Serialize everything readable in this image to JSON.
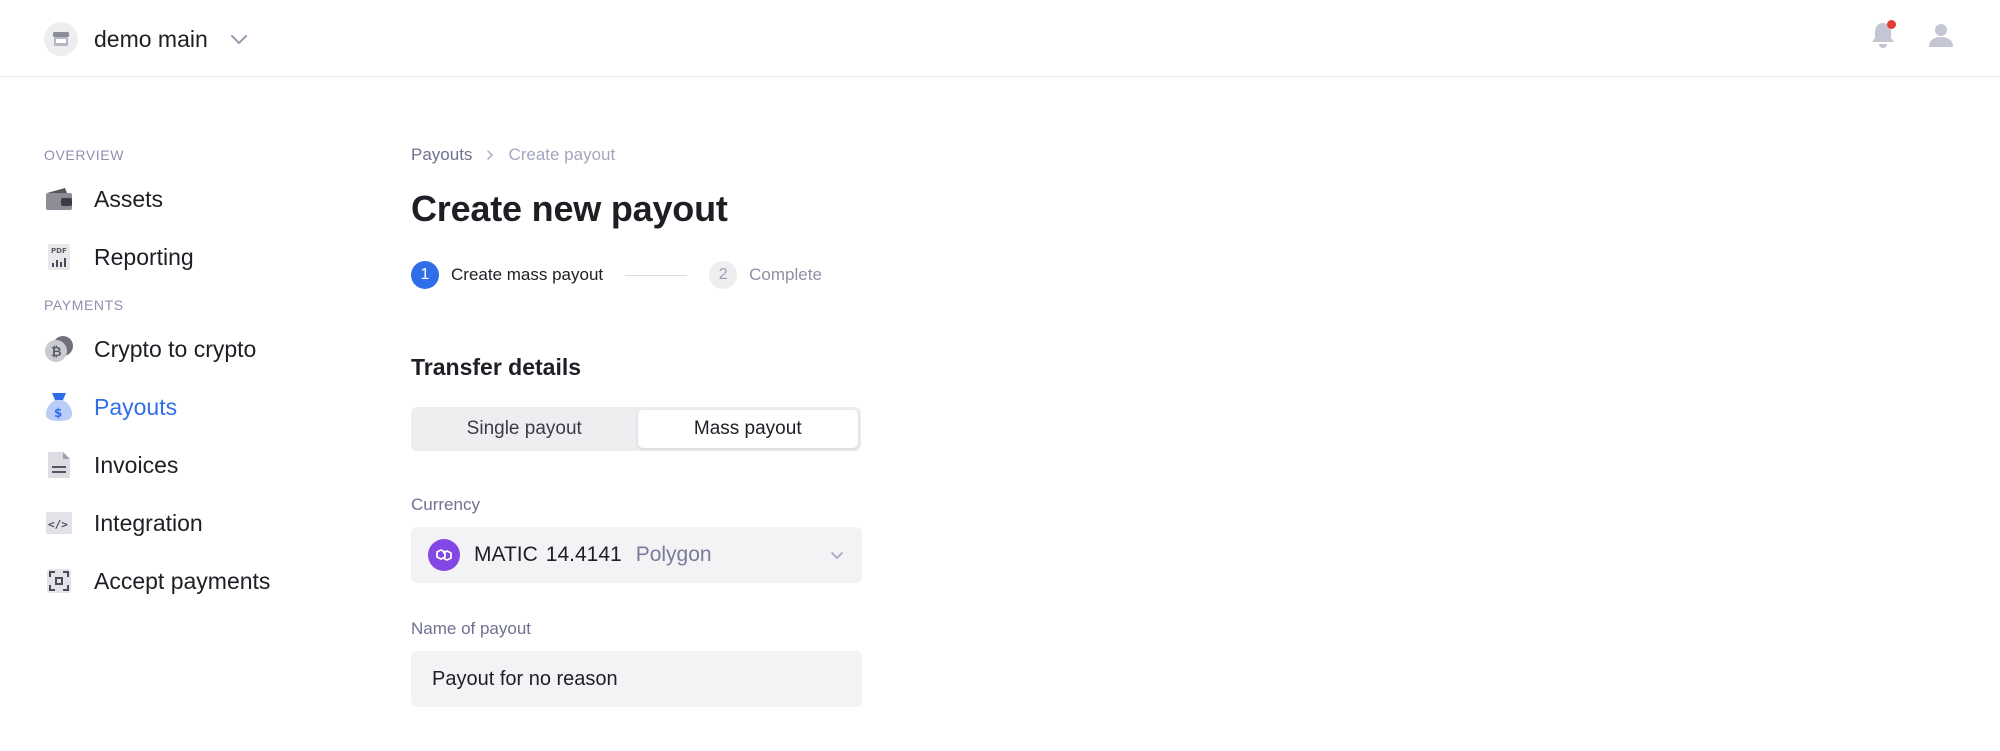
{
  "header": {
    "workspace_name": "demo main",
    "icons": {
      "workspace": "store-icon",
      "chevron": "chevron-down-icon",
      "notifications": "bell-icon",
      "account": "user-icon"
    },
    "notification_dot_color": "#e53935"
  },
  "sidebar": {
    "sections": [
      {
        "label": "OVERVIEW",
        "items": [
          {
            "label": "Assets",
            "icon": "wallet-icon",
            "active": false
          },
          {
            "label": "Reporting",
            "icon": "pdf-report-icon",
            "active": false
          }
        ]
      },
      {
        "label": "PAYMENTS",
        "items": [
          {
            "label": "Crypto to crypto",
            "icon": "bitcoin-coins-icon",
            "active": false
          },
          {
            "label": "Payouts",
            "icon": "money-bag-icon",
            "active": true
          },
          {
            "label": "Invoices",
            "icon": "document-icon",
            "active": false
          },
          {
            "label": "Integration",
            "icon": "code-icon",
            "active": false
          },
          {
            "label": "Accept payments",
            "icon": "qr-scan-icon",
            "active": false
          }
        ]
      }
    ]
  },
  "main": {
    "breadcrumb": {
      "parent": "Payouts",
      "current": "Create payout"
    },
    "title": "Create new payout",
    "stepper": [
      {
        "number": "1",
        "label": "Create mass payout",
        "active": true
      },
      {
        "number": "2",
        "label": "Complete",
        "active": false
      }
    ],
    "section_title": "Transfer details",
    "payout_type": {
      "options": [
        "Single payout",
        "Mass payout"
      ],
      "selected": "Mass payout"
    },
    "currency": {
      "label": "Currency",
      "symbol": "MATIC",
      "amount": "14.4141",
      "network": "Polygon",
      "icon": "polygon-icon"
    },
    "payout_name": {
      "label": "Name of payout",
      "value": "Payout for no reason"
    }
  },
  "colors": {
    "accent": "#2f6ee8",
    "polygon": "#8247e5",
    "muted_text": "#6f7090"
  }
}
